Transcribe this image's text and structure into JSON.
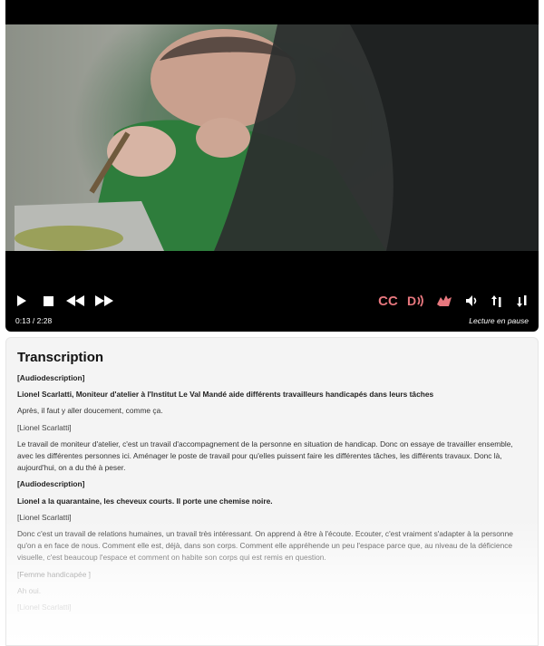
{
  "player": {
    "current_time": "0:13",
    "duration": "2:28",
    "time_display": "0:13 / 2:28",
    "status": "Lecture en pause",
    "controls": {
      "play": "play-icon",
      "stop": "stop-icon",
      "rewind": "rewind-icon",
      "forward": "fast-forward-icon",
      "captions_label": "CC",
      "audio_description": "audio-description-icon",
      "sign_language": "sign-language-icon",
      "mute": "volume-icon",
      "volume_up": "volume-up-icon",
      "volume_down": "volume-down-icon"
    },
    "colors": {
      "accent": "#e7777e",
      "background": "#000000",
      "text": "#ffffff"
    }
  },
  "transcript": {
    "title": "Transcription",
    "entries": [
      {
        "type": "label",
        "text": "[Audiodescription]"
      },
      {
        "type": "desc",
        "text": "Lionel Scarlatti, Moniteur d'atelier à l'Institut Le Val Mandé aide différents travailleurs handicapés dans leurs tâches"
      },
      {
        "type": "speech",
        "text": "Après, il faut y aller doucement, comme ça."
      },
      {
        "type": "speaker",
        "text": "[Lionel Scarlatti]"
      },
      {
        "type": "speech",
        "text": "Le travail de moniteur d'atelier, c'est un travail d'accompagnement de la personne en situation de handicap. Donc on essaye de travailler ensemble, avec les différentes personnes ici. Aménager le poste de travail pour qu'elles puissent faire les différentes tâches, les différents travaux. Donc là, aujourd'hui, on a du thé à peser."
      },
      {
        "type": "label",
        "text": "[Audiodescription]"
      },
      {
        "type": "desc",
        "text": "Lionel a la quarantaine, les cheveux courts. Il porte une chemise noire."
      },
      {
        "type": "speaker",
        "text": "[Lionel Scarlatti]"
      },
      {
        "type": "speech",
        "text": "Donc c'est un travail de relations humaines, un travail très intéressant. On apprend à être à l'écoute. Ecouter, c'est vraiment s'adapter à la personne qu'on a en face de nous. Comment elle est, déjà, dans son corps. Comment elle appréhende un peu l'espace parce que, au niveau de la déficience visuelle, c'est beaucoup l'espace et comment on habite son corps qui est remis en question."
      },
      {
        "type": "speaker",
        "text": "[Femme handicapée ]"
      },
      {
        "type": "speech",
        "text": "Ah oui."
      },
      {
        "type": "speaker",
        "text": "[Lionel Scarlatti]"
      }
    ]
  }
}
